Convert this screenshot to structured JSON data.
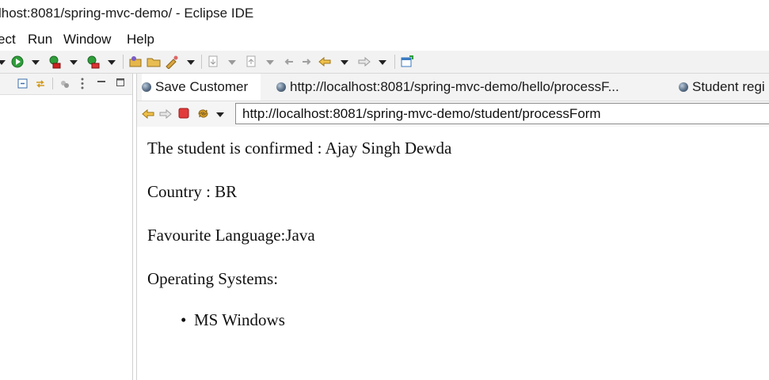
{
  "window": {
    "title": "lhost:8081/spring-mvc-demo/ - Eclipse IDE"
  },
  "menu": {
    "items": [
      "ect",
      "Run",
      "Window",
      "Help"
    ]
  },
  "toolbar": {
    "icons": [
      "debug-dropdown-arrow",
      "run-icon",
      "run-dropdown-arrow",
      "coverage-icon",
      "coverage-dropdown-arrow",
      "external-tools-icon",
      "external-tools-dropdown-arrow",
      "new-java-project-icon",
      "open-folder-icon",
      "open-task-icon",
      "open-task-dropdown-arrow",
      "next-annotation-icon",
      "prev-annotation-icon",
      "last-edit-icon",
      "back-icon",
      "back-dropdown-arrow",
      "forward-icon",
      "forward-dropdown-arrow",
      "open-perspective-icon"
    ]
  },
  "left_panel": {
    "icons": [
      "collapse-all-icon",
      "link-with-editor-icon",
      "filter-icon",
      "view-menu-icon",
      "minimize-icon",
      "maximize-icon"
    ]
  },
  "editor": {
    "tabs": [
      {
        "label": "Save Customer",
        "active": true
      },
      {
        "label": "http://localhost:8081/spring-mvc-demo/hello/processF...",
        "active": false
      },
      {
        "label": "Student regi",
        "active": false
      }
    ],
    "browser": {
      "url": "http://localhost:8081/spring-mvc-demo/student/processForm",
      "nav_icons": [
        "back-icon",
        "forward-icon",
        "stop-icon",
        "refresh-icon",
        "nav-dropdown-arrow"
      ]
    },
    "page": {
      "confirm_line": "The student is confirmed : Ajay Singh Dewda",
      "country_line": "Country : BR",
      "language_line": "Favourite Language:Java",
      "os_heading": "Operating Systems:",
      "os_list": [
        "MS Windows"
      ]
    }
  }
}
